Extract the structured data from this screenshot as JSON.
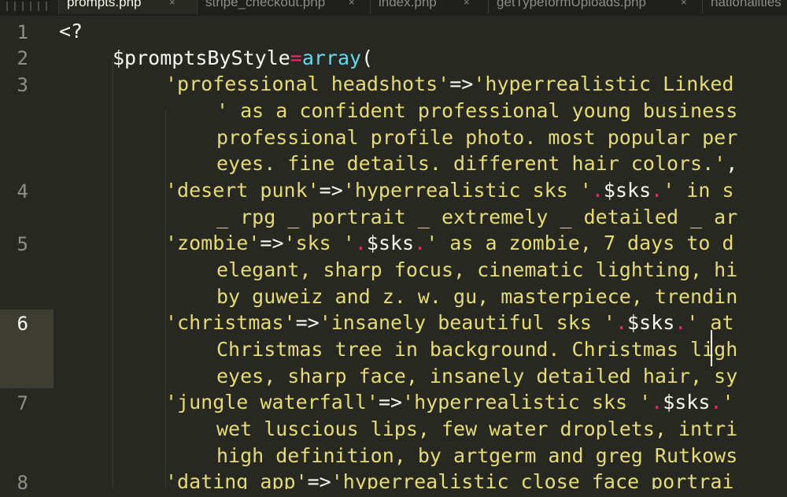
{
  "tabs": [
    {
      "label": "prompts.php",
      "active": true
    },
    {
      "label": "stripe_checkout.php",
      "active": false
    },
    {
      "label": "index.php",
      "active": false
    },
    {
      "label": "getTypeformUploads.php",
      "active": false
    },
    {
      "label": "nationalities",
      "active": false
    }
  ],
  "close_glyph": "×",
  "line_numbers": [
    "1",
    "2",
    "3",
    "4",
    "5",
    "6",
    "7",
    "8"
  ],
  "current_line": "6",
  "code": {
    "l1": {
      "t": "<?"
    },
    "l2": {
      "a": "$promptsByStyle",
      "b": "=",
      "c": "array",
      "d": "("
    },
    "l3a": {
      "a": "'professional headshots'",
      "b": "=>",
      "c": "'hyperrealistic Linked"
    },
    "l3b": {
      "a": "' as a confident professional young business"
    },
    "l3c": {
      "a": "professional profile photo. most popular per"
    },
    "l3d": {
      "a": "eyes. fine details. different hair colors.'",
      "b": ","
    },
    "l4a": {
      "a": "'desert punk'",
      "b": "=>",
      "c": "'hyperrealistic sks '",
      "d": ".",
      "e": "$sks",
      "f": ".",
      "g": "' in s"
    },
    "l4b": {
      "a": "_ rpg _ portrait _ extremely _ detailed _ ar"
    },
    "l5a": {
      "a": "'zombie'",
      "b": "=>",
      "c": "'sks '",
      "d": ".",
      "e": "$sks",
      "f": ".",
      "g": "' as a zombie, 7 days to d"
    },
    "l5b": {
      "a": "elegant, sharp focus, cinematic lighting, hi"
    },
    "l5c": {
      "a": "by guweiz and z. w. gu, masterpiece, trendin"
    },
    "l6a": {
      "a": "'christmas'",
      "b": "=>",
      "c": "'insanely beautiful sks '",
      "d": ".",
      "e": "$sks",
      "f": ".",
      "g": "' at"
    },
    "l6b": {
      "a": "Christmas tree in background. Christmas ligh"
    },
    "l6c": {
      "a": "eyes, sharp face, insanely detailed hair, sy"
    },
    "l7a": {
      "a": "'jungle waterfall'",
      "b": "=>",
      "c": "'hyperrealistic sks '",
      "d": ".",
      "e": "$sks",
      "f": ".",
      "g": "'"
    },
    "l7b": {
      "a": "wet luscious lips, few water droplets, intri"
    },
    "l7c": {
      "a": "high definition, by artgerm and greg Rutkows"
    },
    "l8a": {
      "a": "'dating app'",
      "b": "=>",
      "c": "'hyperrealistic close face portrai"
    }
  },
  "colors": {
    "background": "#272822",
    "string": "#e6db74",
    "operator": "#f92672",
    "function": "#66d9ef",
    "plain": "#f8f8f2",
    "line_number": "#8f908a"
  }
}
